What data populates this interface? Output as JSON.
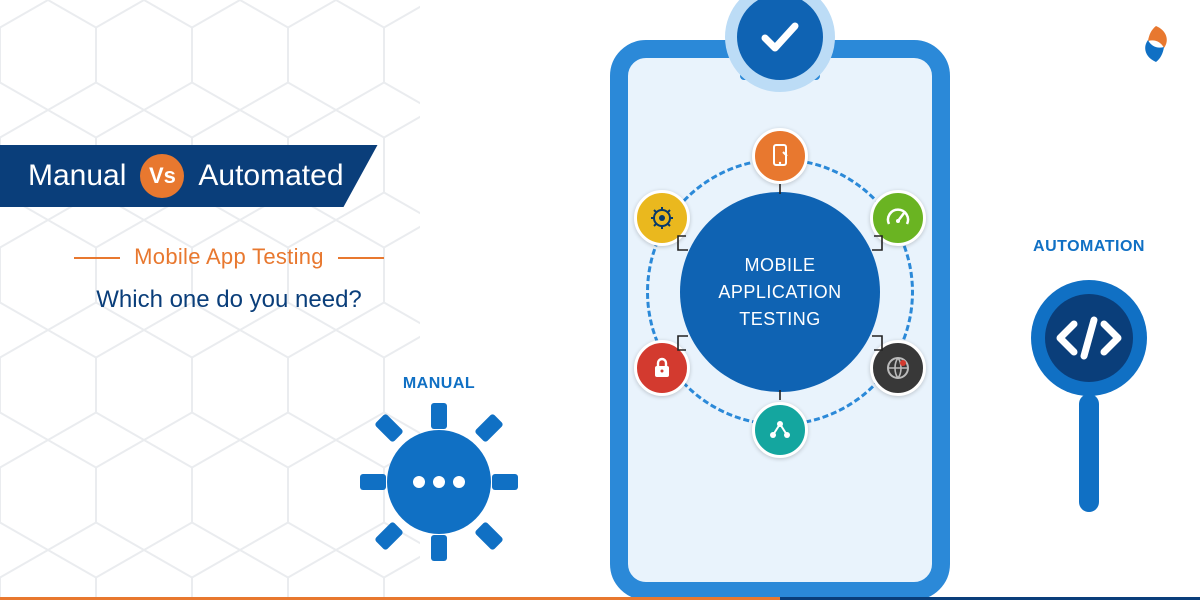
{
  "banner": {
    "left": "Manual",
    "vs": "Vs",
    "right": "Automated"
  },
  "subtitle": {
    "row1": "Mobile App Testing",
    "row2": "Which one do you need?"
  },
  "center": "MOBILE\nAPPLICATION\nTESTING",
  "labels": {
    "manual": "MANUAL",
    "automation": "AUTOMATION"
  },
  "nodes": {
    "top": "touch-phone-icon",
    "upperLeft": "wrench-gear-icon",
    "upperRight": "speedometer-icon",
    "lowerLeft": "lock-icon",
    "lowerRight": "globe-icon",
    "bottom": "share-nodes-icon"
  },
  "colors": {
    "blue": "#0a3e7a",
    "midblue": "#1070c4",
    "orange": "#e8782f"
  }
}
